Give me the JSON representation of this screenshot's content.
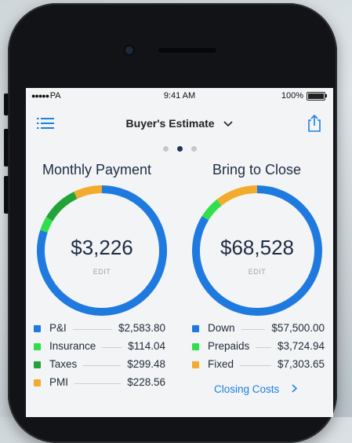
{
  "status_bar": {
    "carrier": "PA",
    "time": "9:41 AM",
    "battery": "100%"
  },
  "nav": {
    "title": "Buyer's Estimate"
  },
  "pager": {
    "count": 3,
    "active": 1
  },
  "monthly": {
    "title": "Monthly Payment",
    "value": "$3,226",
    "edit": "EDIT",
    "items": [
      {
        "label": "P&I",
        "value": "$2,583.80",
        "amount": 2583.8,
        "color": "#1f7ae0"
      },
      {
        "label": "Insurance",
        "value": "$114.04",
        "amount": 114.04,
        "color": "#2fe04c"
      },
      {
        "label": "Taxes",
        "value": "$299.48",
        "amount": 299.48,
        "color": "#22a33a"
      },
      {
        "label": "PMI",
        "value": "$228.56",
        "amount": 228.56,
        "color": "#f3ab2d"
      }
    ]
  },
  "closing": {
    "title": "Bring to Close",
    "value": "$68,528",
    "edit": "EDIT",
    "items": [
      {
        "label": "Down",
        "value": "$57,500.00",
        "amount": 57500.0,
        "color": "#1f7ae0"
      },
      {
        "label": "Prepaids",
        "value": "$3,724.94",
        "amount": 3724.94,
        "color": "#2fe04c"
      },
      {
        "label": "Fixed",
        "value": "$7,303.65",
        "amount": 7303.65,
        "color": "#f3ab2d"
      }
    ],
    "link": "Closing Costs"
  }
}
